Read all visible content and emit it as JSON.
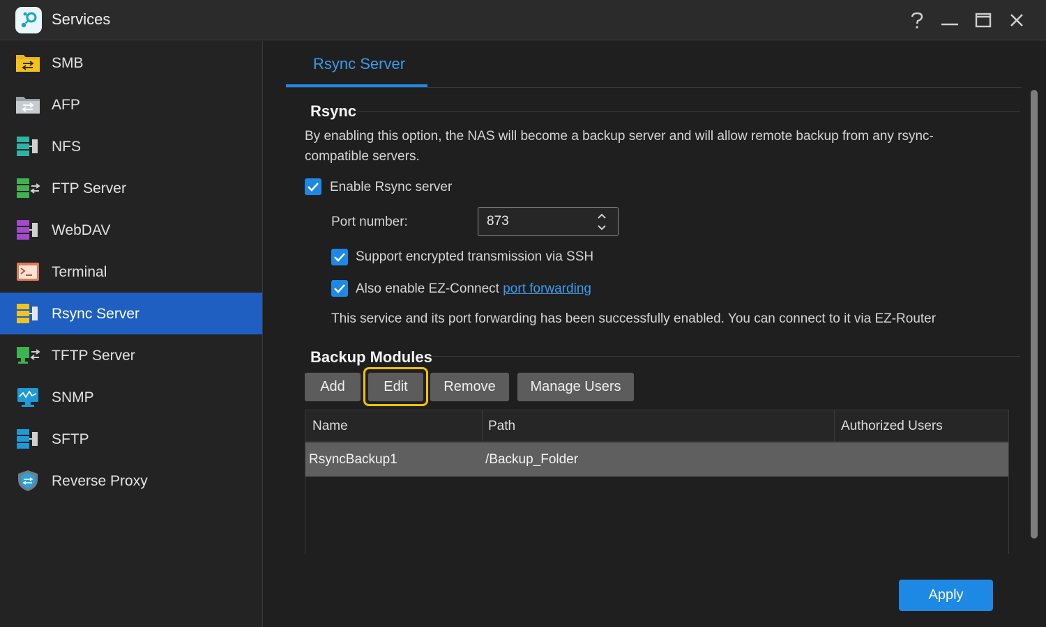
{
  "window": {
    "title": "Services",
    "controls": {
      "help": "help-icon",
      "minimize": "minimize-icon",
      "maximize": "maximize-icon",
      "close": "close-icon"
    }
  },
  "sidebar": {
    "items": [
      {
        "label": "SMB",
        "icon": "smb-folder-icon"
      },
      {
        "label": "AFP",
        "icon": "afp-folder-icon"
      },
      {
        "label": "NFS",
        "icon": "nfs-icon"
      },
      {
        "label": "FTP Server",
        "icon": "ftp-icon"
      },
      {
        "label": "WebDAV",
        "icon": "webdav-icon"
      },
      {
        "label": "Terminal",
        "icon": "terminal-icon"
      },
      {
        "label": "Rsync Server",
        "icon": "rsync-icon",
        "active": true
      },
      {
        "label": "TFTP Server",
        "icon": "tftp-icon"
      },
      {
        "label": "SNMP",
        "icon": "snmp-icon"
      },
      {
        "label": "SFTP",
        "icon": "sftp-icon"
      },
      {
        "label": "Reverse Proxy",
        "icon": "shield-icon"
      }
    ]
  },
  "tabs": [
    {
      "label": "Rsync Server",
      "active": true
    }
  ],
  "rsync": {
    "title": "Rsync",
    "description": "By enabling this option, the NAS will become a backup server and will allow remote backup from any rsync-compatible servers.",
    "enable_label": "Enable Rsync server",
    "enable_checked": true,
    "port_label": "Port number:",
    "port_value": "873",
    "ssh_label": "Support encrypted transmission via SSH",
    "ssh_checked": true,
    "ez_connect_label": "Also enable EZ-Connect",
    "ez_connect_link": "port forwarding",
    "ez_connect_checked": true,
    "status_text": "This service and its port forwarding has been successfully enabled. You can connect to it via EZ-Router"
  },
  "backup_modules": {
    "title": "Backup Modules",
    "buttons": {
      "add": "Add",
      "edit": "Edit",
      "remove": "Remove",
      "manage_users": "Manage Users"
    },
    "columns": [
      "Name",
      "Path",
      "Authorized Users"
    ],
    "rows": [
      {
        "name": "RsyncBackup1",
        "path": "/Backup_Folder",
        "users": ""
      }
    ]
  },
  "footer": {
    "apply_label": "Apply"
  },
  "colors": {
    "accent": "#1e88e5",
    "active_nav": "#1f5fc1",
    "focus": "#f2c200",
    "link": "#3d9be9"
  }
}
